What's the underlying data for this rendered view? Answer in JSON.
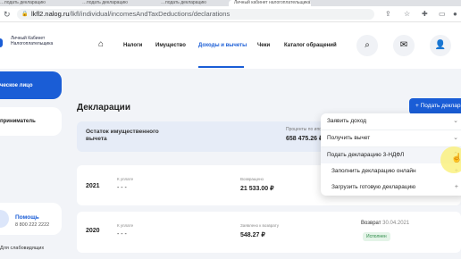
{
  "browser": {
    "tabs": [
      "…подать декларацию",
      "…подать декларацию",
      "…подать декларацию",
      "Личный кабинет налогоплательщика"
    ],
    "url_domain": "lkfl2.nalog.ru",
    "url_path": "/lkfl/individual/incomesAndTaxDeductions/declarations"
  },
  "header": {
    "brand": "Личный Кабинет Налогоплательщика",
    "nav": [
      "Налоги",
      "Имущество",
      "Доходы и вычеты",
      "Чеки",
      "Каталог обращений"
    ],
    "active_nav": "Доходы и вычеты"
  },
  "sidebar": {
    "item1": "ческое лицо",
    "item2": "приниматель",
    "help_title": "Помощь",
    "help_phone": "8 800 222 2222",
    "impaired": "Для слабовидящих"
  },
  "main": {
    "title": "Декларации",
    "submit_button": "+  Подать декларацию",
    "balance_label": "Остаток имущественного вычета",
    "balance_sub": "Проценты по ипотеке",
    "balance_amount": "658 475.26 ₽",
    "declarations": [
      {
        "year": "2021",
        "pay_label": "К уплате",
        "pay_value": "- - -",
        "refund_label": "Возвращено",
        "refund_value": "21 533.00 ₽"
      },
      {
        "year": "2020",
        "pay_label": "К уплате",
        "pay_value": "- - -",
        "refund_label": "Заявлено к возврату",
        "refund_value": "548.27 ₽",
        "status": "Возврат",
        "status_date": "30.04.2021",
        "badge": "Исполнен"
      }
    ]
  },
  "dropdown": {
    "items": [
      {
        "label": "Заявить доход",
        "icon": "chevron-down"
      },
      {
        "label": "Получить вычет",
        "icon": "chevron-down"
      },
      {
        "label": "Подать декларацию 3-НДФЛ",
        "icon": "chevron-up"
      },
      {
        "label": "Заполнить декларацию онлайн",
        "icon": "plus"
      },
      {
        "label": "Загрузить готовую декларацию",
        "icon": "plus"
      }
    ]
  },
  "colors": {
    "accent": "#1a5dd6",
    "page_bg": "#f2f4f8",
    "success": "#2c8a47"
  }
}
